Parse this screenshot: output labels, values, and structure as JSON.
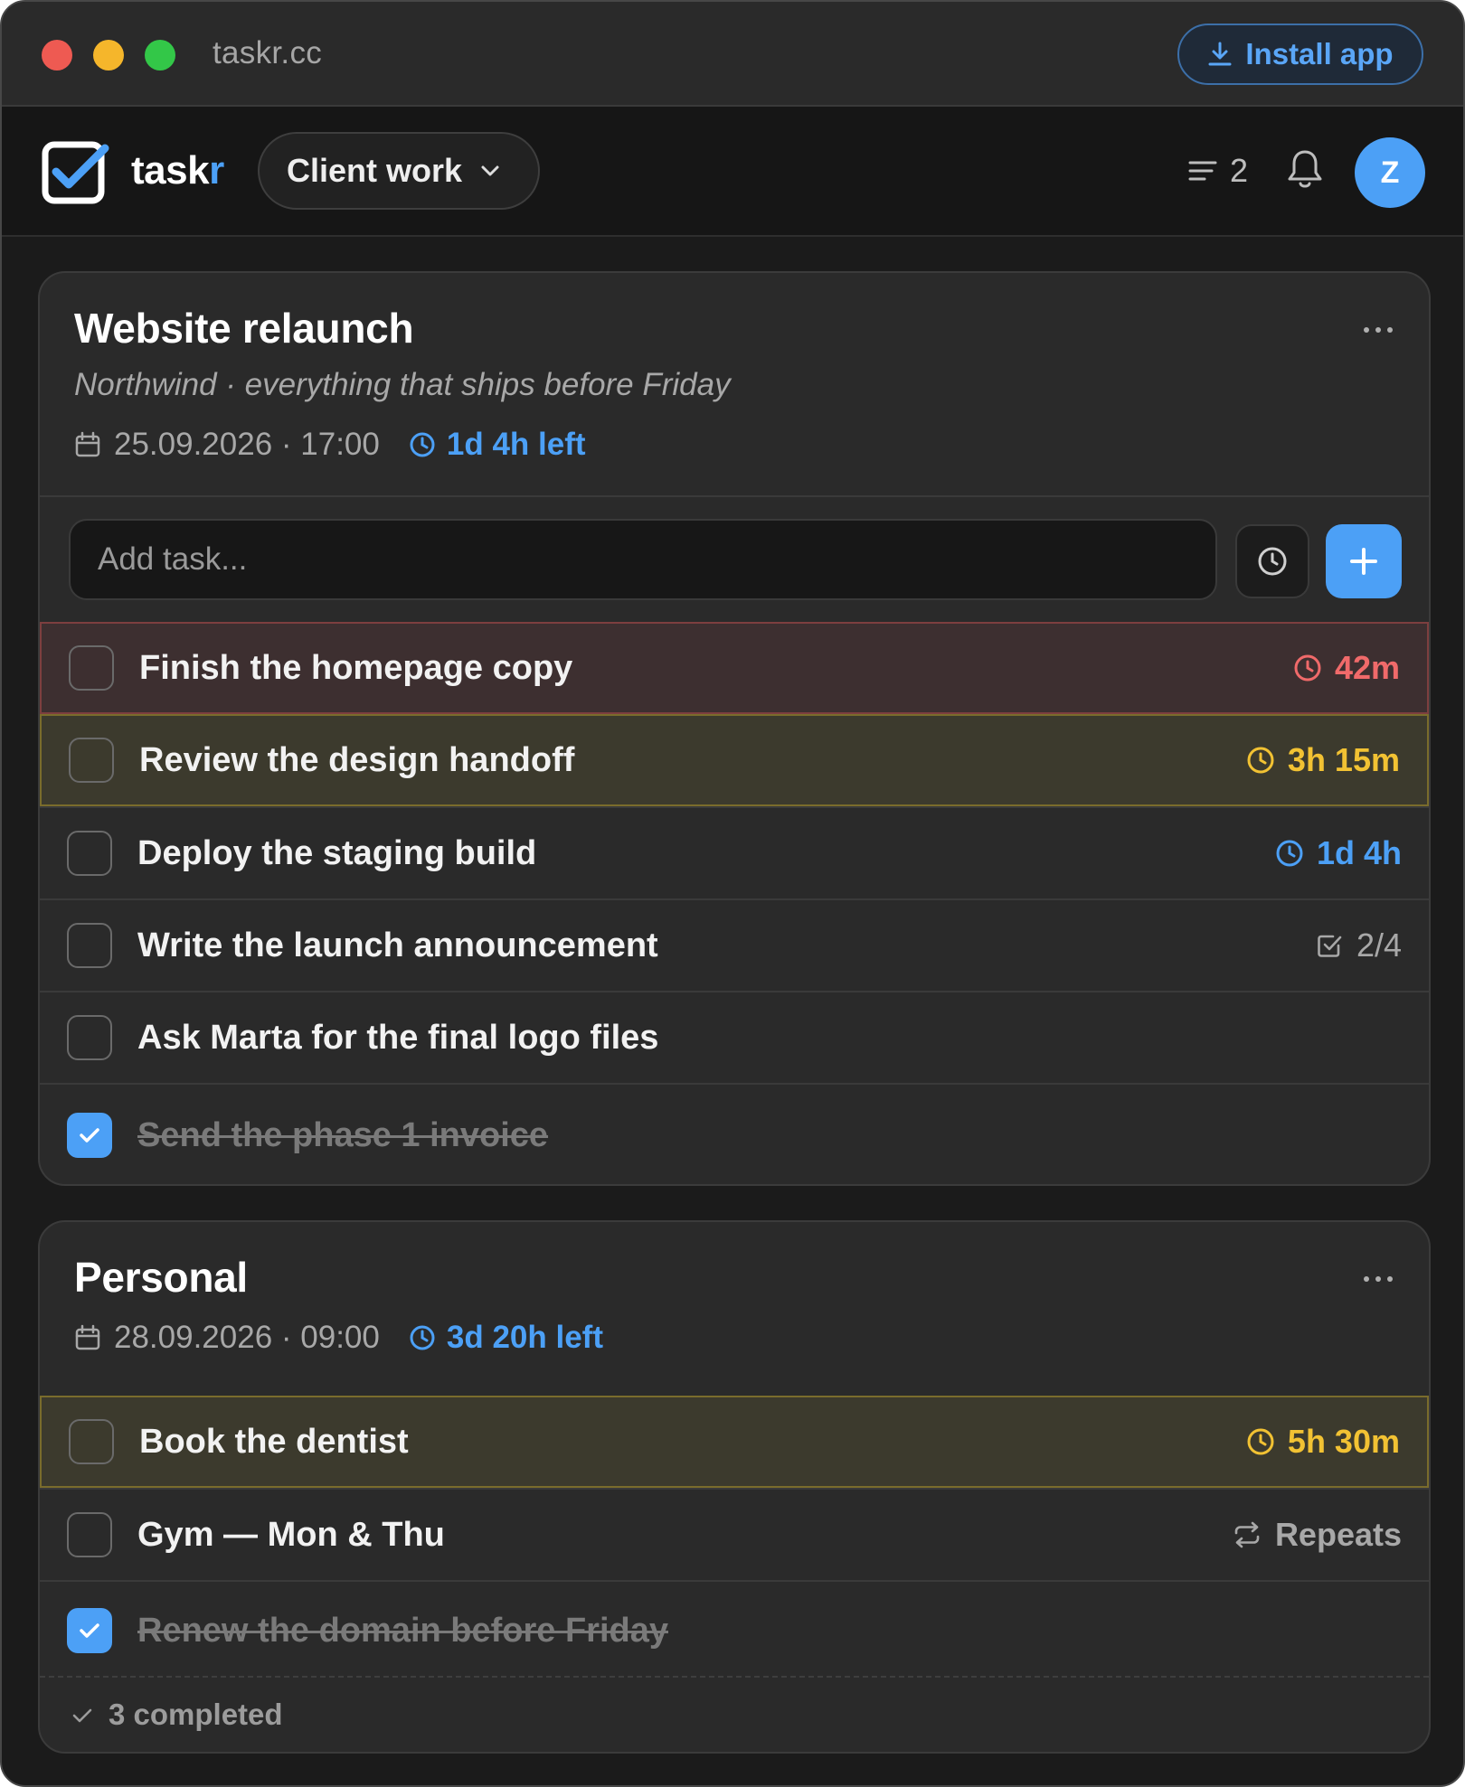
{
  "window": {
    "url": "taskr.cc",
    "install_label": "Install app"
  },
  "header": {
    "brand_main": "task",
    "brand_accent": "r",
    "workspace": "Client work",
    "filter_count": "2",
    "avatar_initial": "Z"
  },
  "colors": {
    "accent": "#4ca0f6",
    "urgent": "#f06a6a",
    "warning": "#f2c233"
  },
  "projects": [
    {
      "title": "Website relaunch",
      "subtitle": "Northwind · everything that ships before Friday",
      "due": "25.09.2026 · 17:00",
      "time_left": "1d 4h left",
      "add_placeholder": "Add task...",
      "tasks": [
        {
          "label": "Finish the homepage copy",
          "badge": "42m",
          "badge_icon": "clock-icon",
          "status": "urgent",
          "done": false
        },
        {
          "label": "Review the design handoff",
          "badge": "3h 15m",
          "badge_icon": "clock-icon",
          "status": "warning",
          "done": false
        },
        {
          "label": "Deploy the staging build",
          "badge": "1d 4h",
          "badge_icon": "clock-icon",
          "status": "normal",
          "done": false
        },
        {
          "label": "Write the launch announcement",
          "badge": "2/4",
          "badge_icon": "subtasks-icon",
          "status": "subtasks",
          "done": false
        },
        {
          "label": "Ask Marta for the final logo files",
          "badge": "",
          "status": "none",
          "done": false
        },
        {
          "label": "Send the phase 1 invoice",
          "badge": "",
          "status": "none",
          "done": true
        }
      ]
    },
    {
      "title": "Personal",
      "due": "28.09.2026 · 09:00",
      "time_left": "3d 20h left",
      "tasks": [
        {
          "label": "Book the dentist",
          "badge": "5h 30m",
          "badge_icon": "clock-icon",
          "status": "warning",
          "done": false
        },
        {
          "label": "Gym — Mon & Thu",
          "badge": "Repeats",
          "badge_icon": "repeat-icon",
          "status": "repeat",
          "done": false
        },
        {
          "label": "Renew the domain before Friday",
          "badge": "",
          "status": "none",
          "done": true
        }
      ],
      "completed_summary": "3 completed"
    }
  ]
}
